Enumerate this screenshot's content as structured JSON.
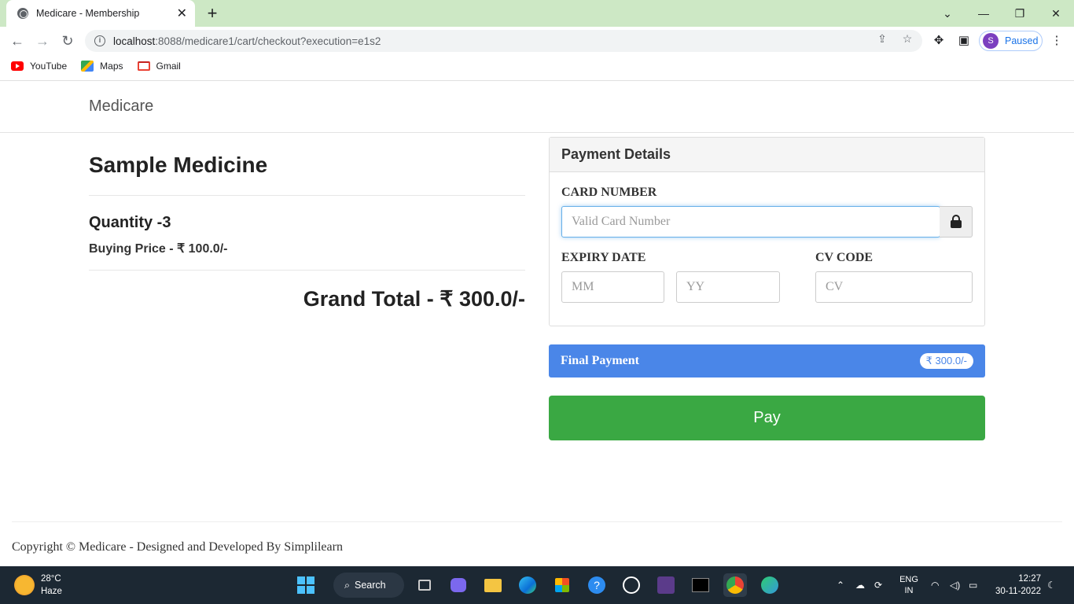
{
  "browser": {
    "tab_title": "Medicare - Membership",
    "tab_close": "✕",
    "new_tab": "+",
    "url_host": "localhost",
    "url_rest": ":8088/medicare1/cart/checkout?execution=e1s2",
    "profile_initial": "S",
    "profile_status": "Paused",
    "bookmarks": [
      {
        "label": "YouTube"
      },
      {
        "label": "Maps"
      },
      {
        "label": "Gmail"
      }
    ]
  },
  "navbar": {
    "brand": "Medicare"
  },
  "product": {
    "name": "Sample Medicine",
    "quantity": "Quantity -3",
    "buying_price": "Buying Price - ₹ 100.0/-",
    "grand_total": "Grand Total - ₹ 300.0/-"
  },
  "payment": {
    "heading": "Payment Details",
    "card_label": "CARD NUMBER",
    "card_placeholder": "Valid Card Number",
    "expiry_label": "EXPIRY DATE",
    "mm_placeholder": "MM",
    "yy_placeholder": "YY",
    "cv_label": "CV CODE",
    "cv_placeholder": "CV",
    "final_label": "Final Payment",
    "final_amount": "₹ 300.0/-",
    "pay_button": "Pay"
  },
  "footer": {
    "text": "Copyright © Medicare - Designed and Developed By Simplilearn"
  },
  "taskbar": {
    "temperature": "28°C",
    "weather": "Haze",
    "search_label": "Search",
    "language_top": "ENG",
    "language_bottom": "IN",
    "time": "12:27",
    "date": "30-11-2022"
  },
  "colors": {
    "pay_green": "#3aa843",
    "final_blue": "#4a86e8",
    "tab_strip": "#cde8c5"
  }
}
